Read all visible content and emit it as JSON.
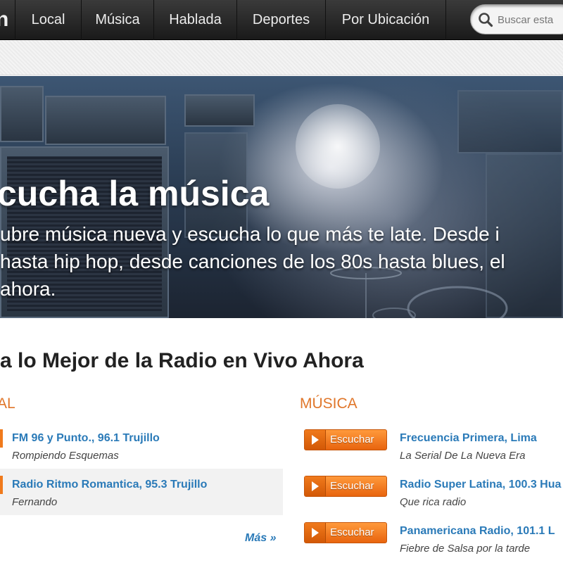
{
  "nav": {
    "logo_fragment": "n",
    "items": [
      {
        "label": "Local"
      },
      {
        "label": "Música"
      },
      {
        "label": "Hablada"
      },
      {
        "label": "Deportes"
      },
      {
        "label": "Por Ubicación"
      }
    ],
    "search": {
      "placeholder": "Buscar esta",
      "icon": "search-icon"
    }
  },
  "hero": {
    "title": "cucha la música",
    "description_lines": [
      "ubre música nueva y escucha lo que más te late. Desde i",
      "hasta hip hop, desde canciones de los 80s hasta blues, el",
      " ahora."
    ]
  },
  "section": {
    "title": "a lo Mejor de la Radio en Vivo Ahora",
    "local": {
      "heading": "AL",
      "stations": [
        {
          "name": "FM 96 y Punto., 96.1 Trujillo",
          "description": "Rompiendo Esquemas"
        },
        {
          "name": "Radio Ritmo Romantica, 95.3 Trujillo",
          "description": "Fernando"
        }
      ],
      "more_label": "Más »"
    },
    "music": {
      "heading": "MÚSICA",
      "button_label": "Escuchar",
      "stations": [
        {
          "name": "Frecuencia Primera, Lima",
          "description": "La Serial De La Nueva Era"
        },
        {
          "name": "Radio Super Latina, 100.3 Hua",
          "description": "Que rica radio"
        },
        {
          "name": "Panamericana Radio, 101.1 L",
          "description": "Fiebre de Salsa por la tarde"
        }
      ]
    }
  },
  "colors": {
    "nav_bg": "#1f1f1f",
    "accent_orange": "#e0762a",
    "link_blue": "#2a7ab8",
    "button_orange": "#f07a1c"
  }
}
